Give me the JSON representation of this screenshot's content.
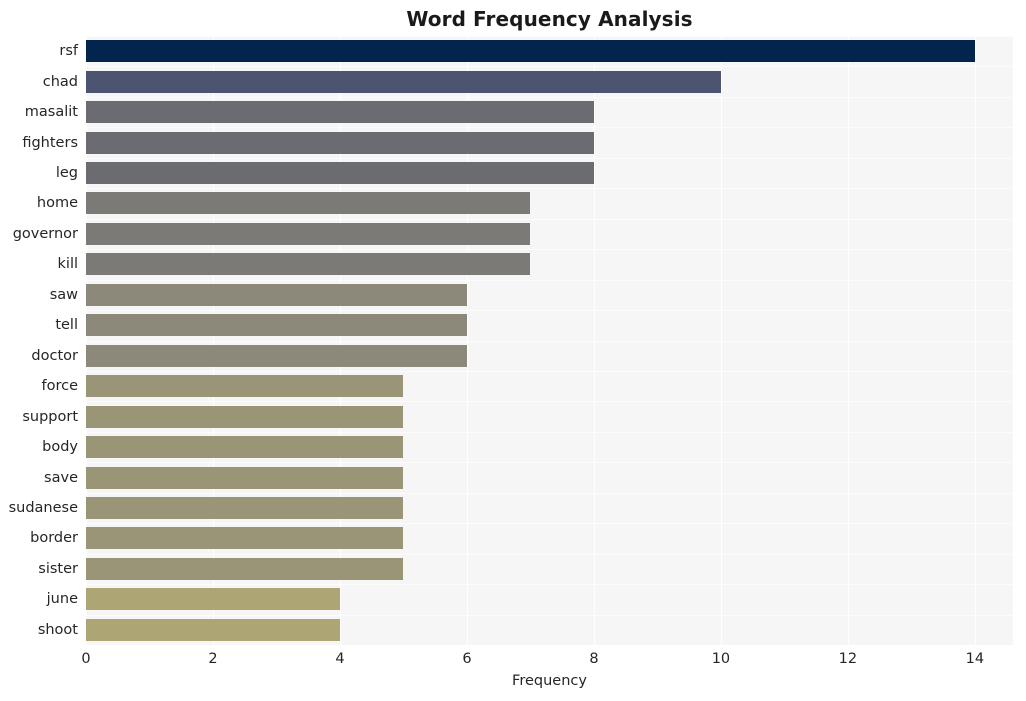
{
  "chart_data": {
    "type": "bar",
    "orientation": "horizontal",
    "title": "Word Frequency Analysis",
    "xlabel": "Frequency",
    "ylabel": "",
    "categories": [
      "rsf",
      "chad",
      "masalit",
      "fighters",
      "leg",
      "home",
      "governor",
      "kill",
      "saw",
      "tell",
      "doctor",
      "force",
      "support",
      "body",
      "save",
      "sudanese",
      "border",
      "sister",
      "june",
      "shoot"
    ],
    "values": [
      14,
      10,
      8,
      8,
      8,
      7,
      7,
      7,
      6,
      6,
      6,
      5,
      5,
      5,
      5,
      5,
      5,
      5,
      4,
      4
    ],
    "xticks": [
      0,
      2,
      4,
      6,
      8,
      10,
      12,
      14
    ],
    "xtick_labels": [
      "0",
      "2",
      "4",
      "6",
      "8",
      "10",
      "12",
      "14"
    ],
    "xlim": [
      0,
      14.6
    ],
    "grid": true,
    "legend": null,
    "bar_colors": [
      "#03244d",
      "#4c5472",
      "#6b6c71",
      "#6b6c71",
      "#6b6c71",
      "#7b7a76",
      "#7b7a76",
      "#7b7a76",
      "#8d897a",
      "#8d897a",
      "#8d897a",
      "#9b9578",
      "#9b9578",
      "#9b9578",
      "#9b9578",
      "#9b9578",
      "#9b9578",
      "#9b9578",
      "#ada573",
      "#ada573"
    ],
    "plot_background": "#f6f6f7",
    "figure_background": "#ffffff",
    "text_color": "#262626",
    "grid_color": "#ffffff"
  }
}
